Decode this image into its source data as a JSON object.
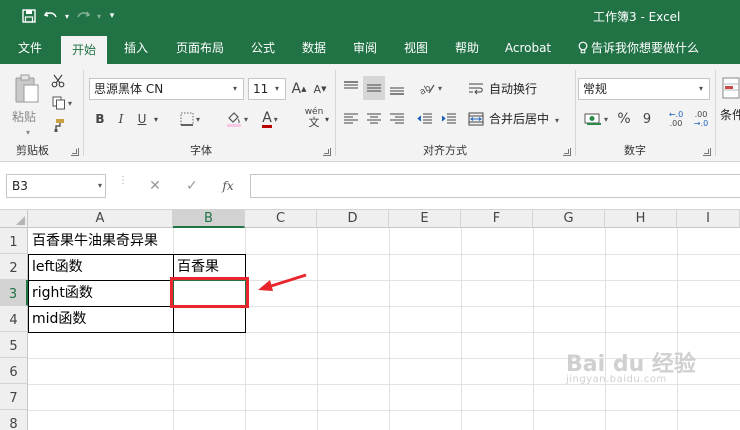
{
  "window": {
    "title": "工作簿3  -  Excel"
  },
  "tabs": [
    {
      "label": "文件",
      "active": false
    },
    {
      "label": "开始",
      "active": true
    },
    {
      "label": "插入",
      "active": false
    },
    {
      "label": "页面布局",
      "active": false
    },
    {
      "label": "公式",
      "active": false
    },
    {
      "label": "数据",
      "active": false
    },
    {
      "label": "审阅",
      "active": false
    },
    {
      "label": "视图",
      "active": false
    },
    {
      "label": "帮助",
      "active": false
    },
    {
      "label": "Acrobat",
      "active": false
    }
  ],
  "tell_me": "告诉我你想要做什么",
  "ribbon": {
    "clipboard": {
      "label": "剪贴板",
      "paste_label": "粘贴"
    },
    "font": {
      "label": "字体",
      "font_name": "思源黑体 CN",
      "font_size": "11",
      "bold": "B",
      "italic": "I",
      "underline": "U",
      "grow": "A",
      "shrink": "A",
      "font_color": "A",
      "phonetic": "wén"
    },
    "alignment": {
      "label": "对齐方式",
      "wrap_text": "自动换行",
      "merge_center": "合并后居中"
    },
    "number": {
      "label": "数字",
      "format": "常规",
      "percent": "%",
      "comma": "9",
      "inc_dec": ".00",
      "dec_dec": ".00"
    },
    "styles": {
      "label": "条件"
    }
  },
  "formula_bar": {
    "name_box": "B3",
    "fx": "fx",
    "cancel": "✕",
    "enter": "✓",
    "value": ""
  },
  "sheet": {
    "columns": [
      "A",
      "B",
      "C",
      "D",
      "E",
      "F",
      "G",
      "H",
      "I"
    ],
    "rows": [
      "1",
      "2",
      "3",
      "4",
      "5",
      "6",
      "7",
      "8"
    ],
    "selected_column": "B",
    "selected_row": "3",
    "cells": {
      "A1": "百香果牛油果奇异果",
      "A2": "left函数",
      "B2": "百香果",
      "A3": "right函数",
      "A4": "mid函数"
    }
  },
  "colors": {
    "excel_green": "#217346",
    "annotation_red": "#e8262b"
  },
  "watermark": {
    "main": "Bai du 经验",
    "sub": "jingyan.baidu.com"
  }
}
